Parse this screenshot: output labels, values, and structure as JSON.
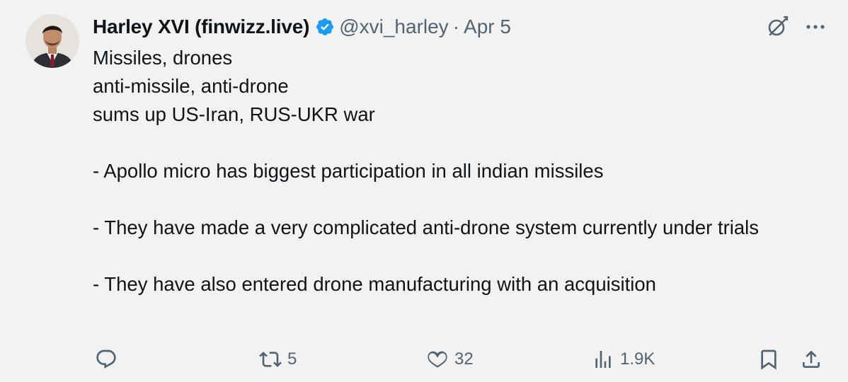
{
  "tweet": {
    "author": {
      "display_name": "Harley XVI (finwizz.live)",
      "handle": "@xvi_harley",
      "verified": true
    },
    "separator": "·",
    "date": "Apr 5",
    "lines": [
      "Missiles, drones",
      "anti-missile, anti-drone",
      "sums up US-Iran, RUS-UKR war",
      "",
      "- Apollo micro has biggest participation in all indian missiles",
      "",
      "- They have made a very complicated anti-drone system currently under trials",
      "",
      "- They have also entered drone manufacturing with an acquisition"
    ]
  },
  "actions": {
    "reply": {
      "icon": "reply-icon",
      "count": ""
    },
    "retweet": {
      "icon": "retweet-icon",
      "count": "5"
    },
    "like": {
      "icon": "heart-icon",
      "count": "32"
    },
    "views": {
      "icon": "views-icon",
      "count": "1.9K"
    },
    "bookmark": {
      "icon": "bookmark-icon"
    },
    "share": {
      "icon": "share-icon"
    }
  },
  "colors": {
    "background": "#f2f2f2",
    "text": "#0f1419",
    "muted": "#536471",
    "verified": "#1d9bf0"
  }
}
